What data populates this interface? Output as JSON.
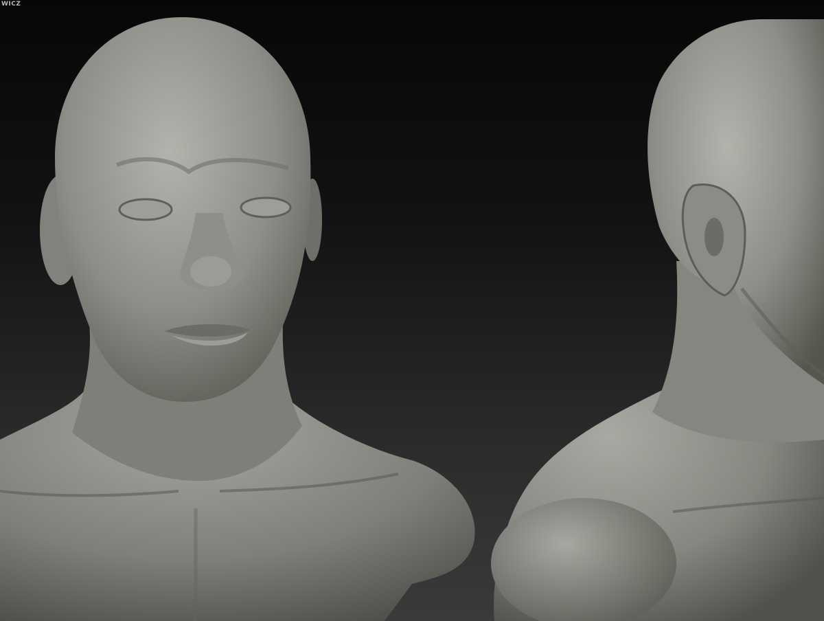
{
  "image": {
    "watermark_text": "WICZ",
    "views": [
      {
        "name": "front-view"
      },
      {
        "name": "three-quarter-side-view"
      }
    ],
    "colors": {
      "background_top": "#070707",
      "background_bottom": "#3a3a3a",
      "clay_light": "#a9aca4",
      "clay_mid": "#7f827b",
      "clay_dark": "#4a4c47"
    }
  }
}
